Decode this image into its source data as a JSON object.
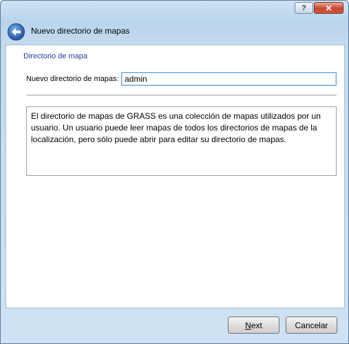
{
  "window": {
    "title": "Nuevo directorio de mapas",
    "help_label": "?",
    "close_label": "✕"
  },
  "page": {
    "section_title": "Directorio de mapa",
    "mapset_label": "Nuevo directorio de mapas:",
    "mapset_value": "admin",
    "description": "El directorio de mapas de GRASS es una colección de mapas utilizados por un usuario. Un usuario puede leer mapas de todos los directorios de mapas de la localización, pero sólo puede abrir para editar su directorio de mapas."
  },
  "buttons": {
    "next_accel": "N",
    "next_rest": "ext",
    "cancel": "Cancelar"
  }
}
